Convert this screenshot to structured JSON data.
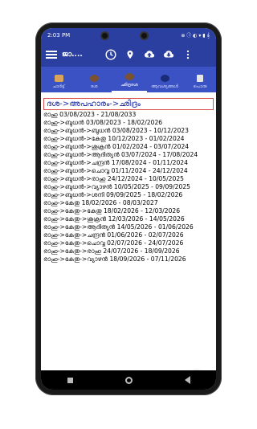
{
  "status_bar": {
    "time": "2:03 PM",
    "icons_text": "⊕ ⓘ ◐ ▾ ▮ 𝄞"
  },
  "app_bar": {
    "title": "ജാ...."
  },
  "tabs": [
    {
      "label": "ചാർട്ട്"
    },
    {
      "label": "ദശ"
    },
    {
      "label": "ഛിദ്രദശ"
    },
    {
      "label": "ആവശ്യങ്ങൾ"
    },
    {
      "label": "പൊരു"
    }
  ],
  "content": {
    "heading": "ദശ->അപഹാരം->ഛിദ്രം",
    "rows": [
      "രാഹു 03/08/2023 - 21/08/2033",
      "രാഹു->ബുധൻ 03/08/2023 - 18/02/2026",
      "രാഹു->ബുധൻ->ബുധൻ 03/08/2023 - 10/12/2023",
      "രാഹു->ബുധൻ->കേതു 10/12/2023 - 01/02/2024",
      "രാഹു->ബുധൻ->ശുക്രൻ 01/02/2024 - 03/07/2024",
      "രാഹു->ബുധൻ->ആദിത്യൻ 03/07/2024 - 17/08/2024",
      "രാഹു->ബുധൻ->ചന്ദ്രൻ 17/08/2024 - 01/11/2024",
      "രാഹു->ബുധൻ->ചൊവ്വ 01/11/2024 - 24/12/2024",
      "രാഹു->ബുധൻ->രാഹു 24/12/2024 - 10/05/2025",
      "രാഹു->ബുധൻ->വ്യാഴൻ 10/05/2025 - 09/09/2025",
      "രാഹു->ബുധൻ->ശനി 09/09/2025 - 18/02/2026",
      "രാഹു->കേതു 18/02/2026 - 08/03/2027",
      "രാഹു->കേതു->കേതു 18/02/2026 - 12/03/2026",
      "രാഹു->കേതു->ശുക്രൻ 12/03/2026 - 14/05/2026",
      "രാഹു->കേതു->ആദിത്യൻ 14/05/2026 - 01/06/2026",
      "രാഹു->കേതു->ചന്ദ്രൻ 01/06/2026 - 02/07/2026",
      "രാഹു->കേതു->ചൊവ്വ 02/07/2026 - 24/07/2026",
      "രാഹു->കേതു->രാഹു 24/07/2026 - 18/09/2026",
      "രാഹു->കേതു->വ്യാഴൻ 18/09/2026 - 07/11/2026"
    ]
  },
  "colors": {
    "primary": "#2b3fa0",
    "tab_bar": "#3a52c4",
    "heading_text": "#1f2fa8",
    "heading_border": "#d9534f",
    "fab": "#e8336b"
  }
}
